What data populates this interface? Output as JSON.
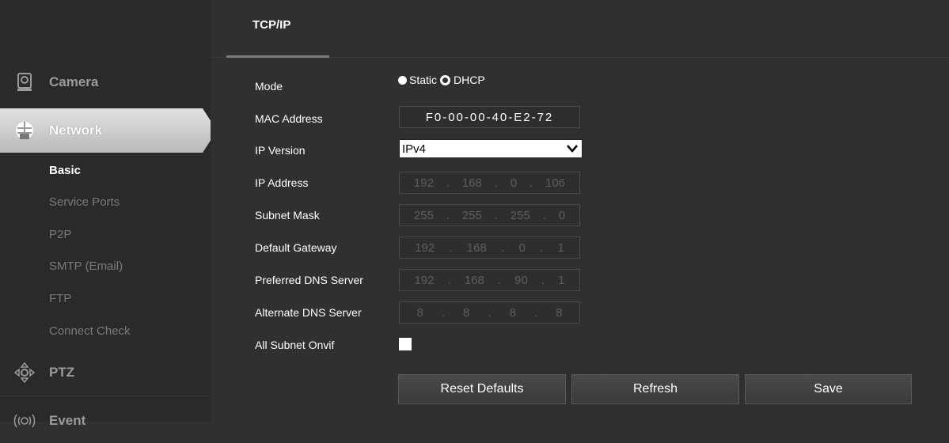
{
  "sidebar": {
    "camera": "Camera",
    "network": "Network",
    "network_sub": [
      "Basic",
      "Service Ports",
      "P2P",
      "SMTP (Email)",
      "FTP",
      "Connect Check"
    ],
    "ptz": "PTZ",
    "event": "Event",
    "icons": [
      "camera-icon",
      "network-icon",
      "ptz-icon",
      "event-icon"
    ]
  },
  "tab": {
    "label": "TCP/IP"
  },
  "form": {
    "mode_label": "Mode",
    "mode_options": [
      "Static",
      "DHCP"
    ],
    "mode_selected": "DHCP",
    "mac_label": "MAC Address",
    "mac_value": "F0-00-00-40-E2-72",
    "ipver_label": "IP Version",
    "ipver_value": "IPv4",
    "ip_label": "IP Address",
    "ip_value": [
      "192",
      "168",
      "0",
      "106"
    ],
    "subnet_label": "Subnet Mask",
    "subnet_value": [
      "255",
      "255",
      "255",
      "0"
    ],
    "gateway_label": "Default Gateway",
    "gateway_value": [
      "192",
      "168",
      "0",
      "1"
    ],
    "pdns_label": "Preferred DNS Server",
    "pdns_value": [
      "192",
      "168",
      "90",
      "1"
    ],
    "adns_label": "Alternate DNS Server",
    "adns_value": [
      "8",
      "8",
      "8",
      "8"
    ],
    "onvif_label": "All Subnet Onvif",
    "onvif_checked": false
  },
  "buttons": {
    "reset": "Reset Defaults",
    "refresh": "Refresh",
    "save": "Save"
  },
  "colors": {
    "background": "#303030",
    "sidebar": "#2a2a2a",
    "active_nav": "#c8c8c8",
    "inactive_text": "#7a7a7a"
  }
}
